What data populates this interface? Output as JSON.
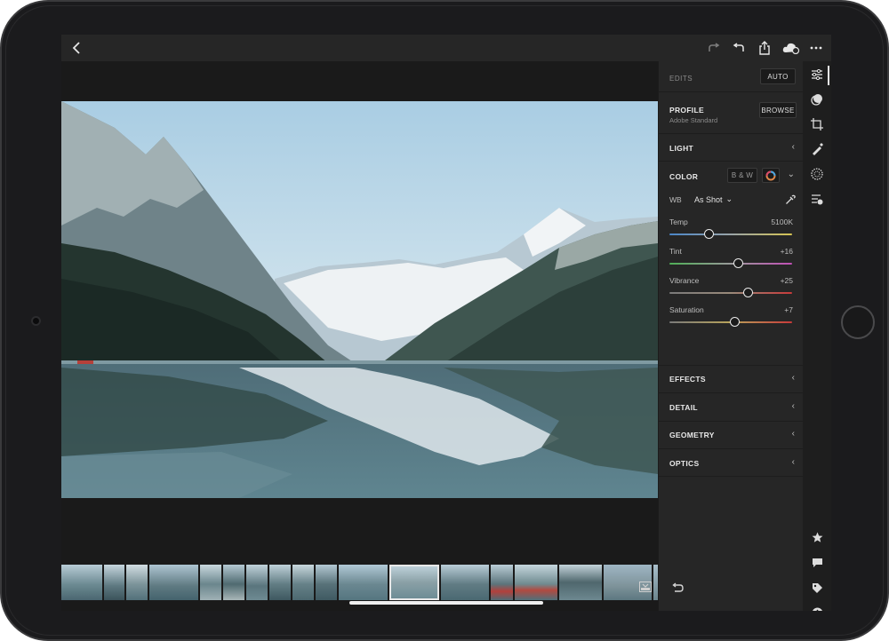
{
  "edits_label": "EDITS",
  "auto_label": "AUTO",
  "profile": {
    "title": "PROFILE",
    "value": "Adobe Standard",
    "browse_label": "BROWSE"
  },
  "light_label": "LIGHT",
  "color": {
    "title": "COLOR",
    "bw_label": "B & W",
    "wb_label": "WB",
    "wb_value": "As Shot",
    "temp": {
      "label": "Temp",
      "value": "5100K",
      "fraction": 0.32
    },
    "tint": {
      "label": "Tint",
      "value": "+16",
      "fraction": 0.56
    },
    "vibrance": {
      "label": "Vibrance",
      "value": "+25",
      "fraction": 0.64
    },
    "saturation": {
      "label": "Saturation",
      "value": "+7",
      "fraction": 0.53
    }
  },
  "sections": {
    "effects": "EFFECTS",
    "detail": "DETAIL",
    "geometry": "GEOMETRY",
    "optics": "OPTICS"
  },
  "icons": {
    "back": "chevron-left-icon",
    "redo": "redo-icon",
    "undo": "undo-icon",
    "share": "share-icon",
    "cloud": "cloud-sync-icon",
    "more": "more-icon",
    "edit": "sliders-icon",
    "selective": "selective-edit-icon",
    "crop": "crop-icon",
    "healing": "healing-brush-icon",
    "presets": "presets-icon",
    "versions": "versions-icon",
    "star": "star-icon",
    "comment": "comment-icon",
    "tag": "tag-icon",
    "info": "info-icon",
    "reset": "reset-icon",
    "filmstrip_toggle": "filmstrip-toggle-icon"
  },
  "colors": {
    "panel_bg": "#262626",
    "app_bg": "#1a1a1a",
    "accent": "#e8e8e8"
  }
}
